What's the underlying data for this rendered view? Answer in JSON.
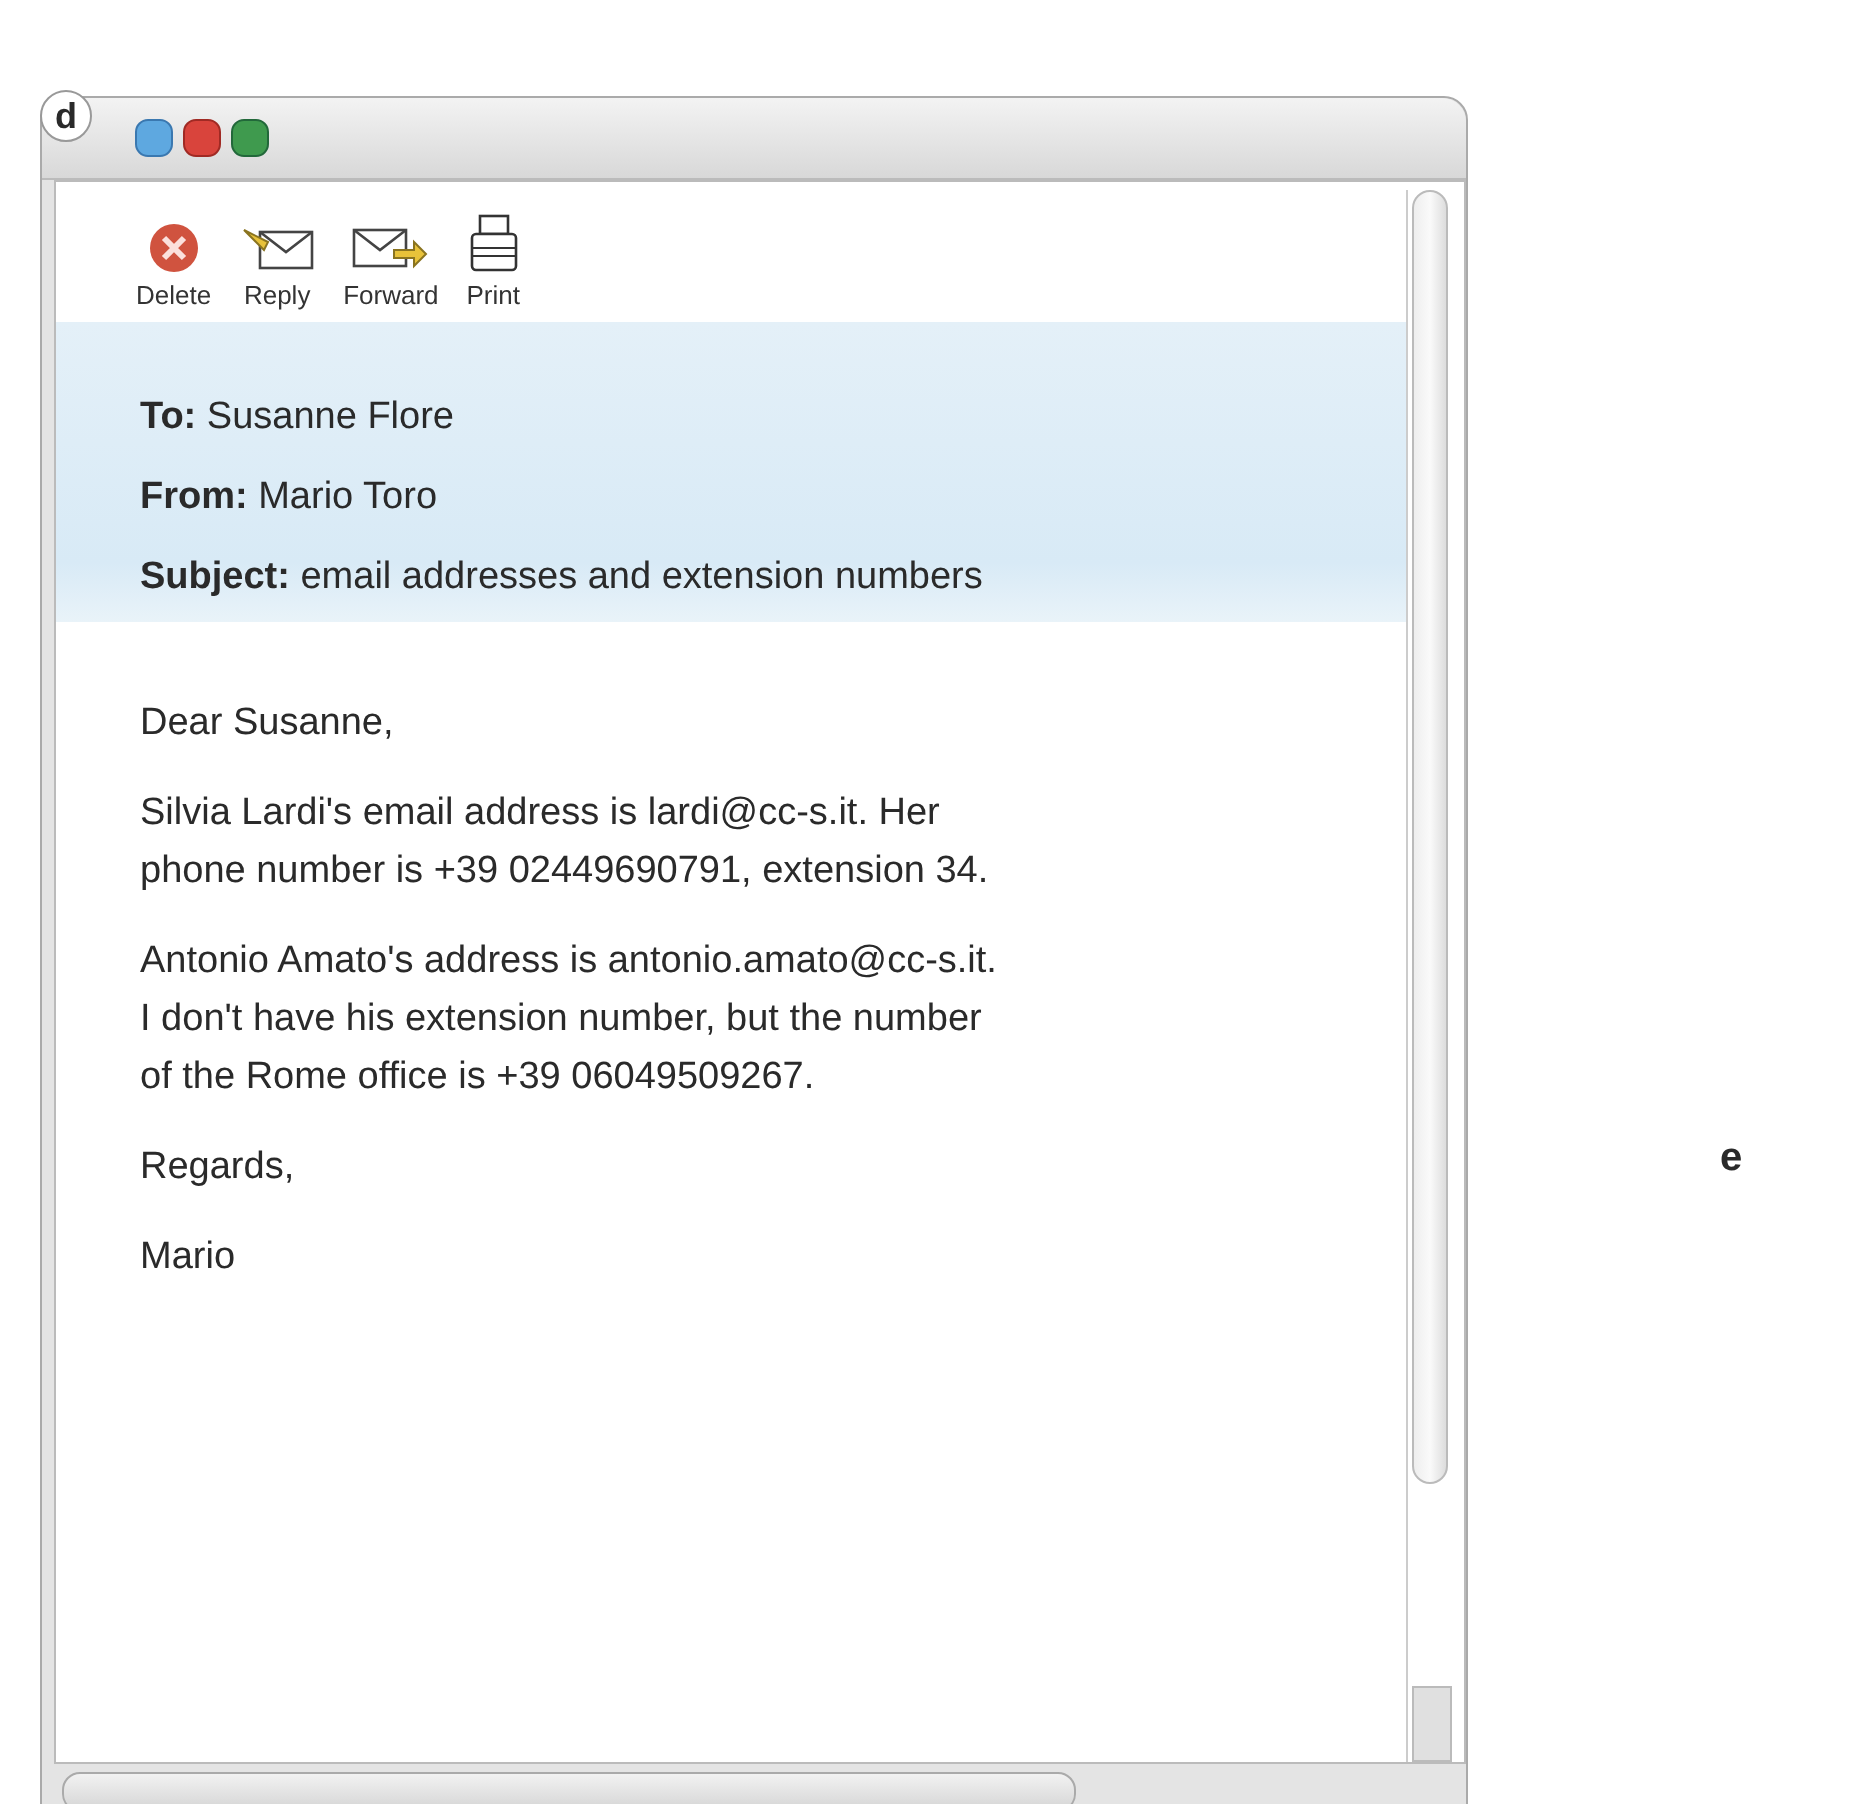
{
  "panel_label": "d",
  "toolbar": [
    {
      "kind": "delete",
      "label": "Delete"
    },
    {
      "kind": "reply",
      "label": "Reply"
    },
    {
      "kind": "forward",
      "label": "Forward"
    },
    {
      "kind": "print",
      "label": "Print"
    }
  ],
  "header": [
    {
      "label": "To:",
      "value": "Susanne Flore"
    },
    {
      "label": "From:",
      "value": "Mario Toro"
    },
    {
      "label": "Subject:",
      "value": "email addresses and extension numbers"
    }
  ],
  "body": [
    {
      "lines": [
        "Dear Susanne,"
      ]
    },
    {
      "lines": [
        "Silvia Lardi's email address is lardi@cc-s.it. Her",
        "phone number is +39 02449690791, extension 34."
      ]
    },
    {
      "lines": [
        "Antonio Amato's address is antonio.amato@cc-s.it.",
        "I don't have his extension number, but the number",
        "of the Rome office is +39 06049509267."
      ]
    },
    {
      "lines": [
        "Regards,"
      ]
    },
    {
      "lines": [
        "Mario"
      ]
    }
  ],
  "side_label": "e"
}
